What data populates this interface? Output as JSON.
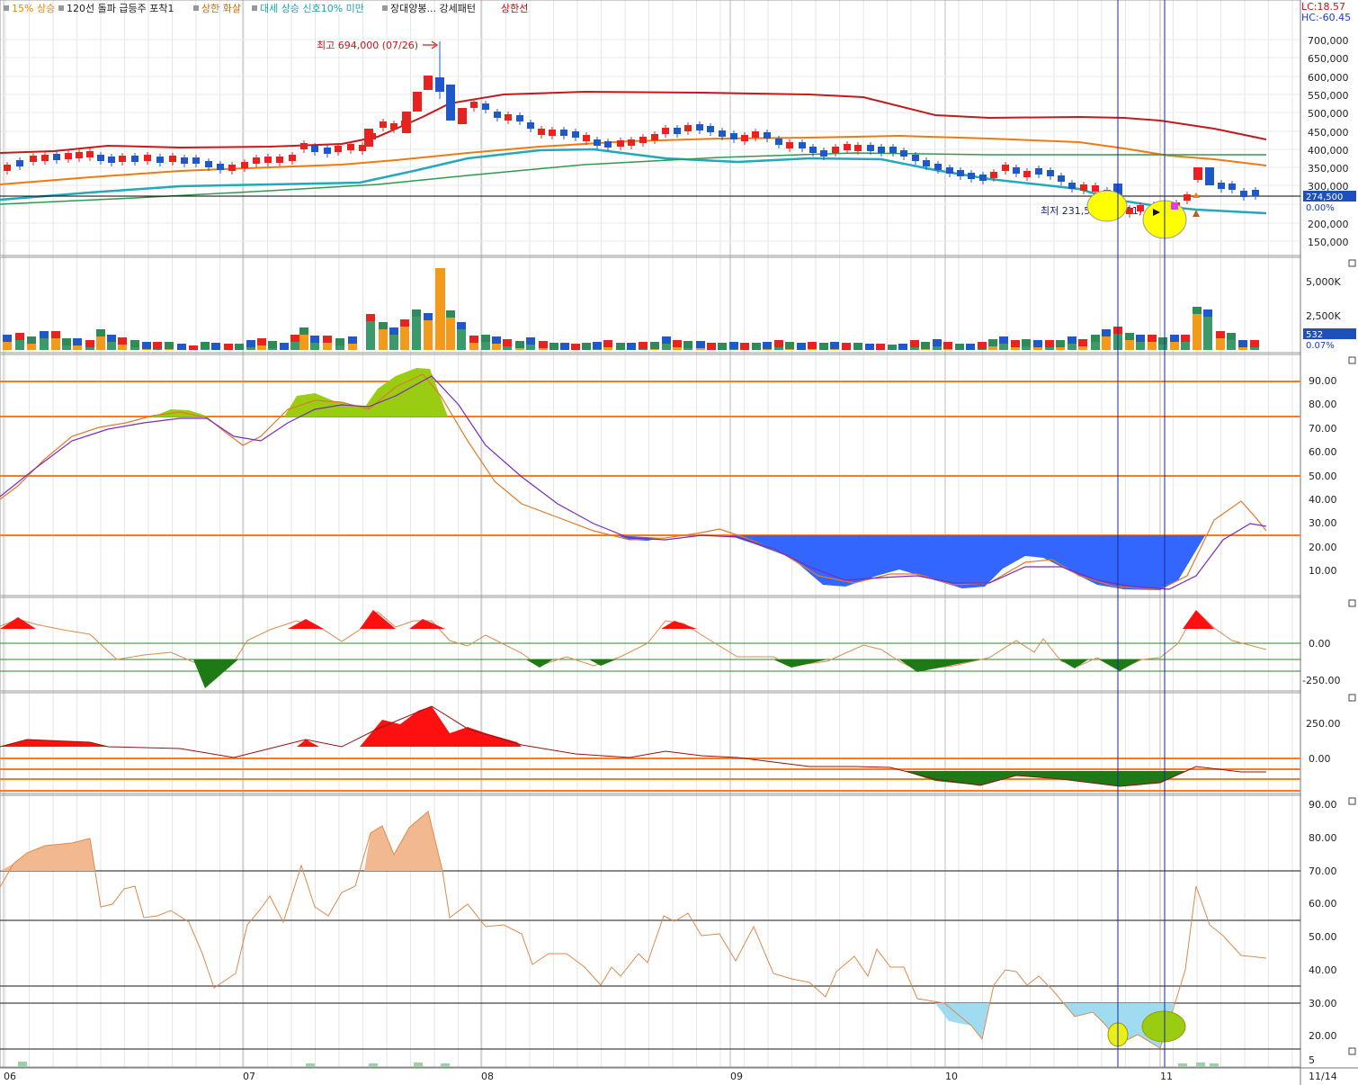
{
  "legend": [
    {
      "label": "15% 상승",
      "color": "#e08a00"
    },
    {
      "label": "120선 돌파 급등주 포착1",
      "color": "#222222"
    },
    {
      "label": "상한 화살",
      "color": "#d46a00"
    },
    {
      "label": "대세 상승 신호10% 미만",
      "color": "#19a7b0"
    },
    {
      "label": "장대양봉... 강세패턴",
      "color": "#222222"
    },
    {
      "label": "상한선",
      "color": "#cc0000"
    }
  ],
  "top_right": {
    "lc": "LC:18.57",
    "hc": "HC:-60.45"
  },
  "price_panel": {
    "ticks": [
      "700,000",
      "650,000",
      "600,000",
      "550,000",
      "500,000",
      "450,000",
      "400,000",
      "350,000",
      "300,000",
      "250,000",
      "200,000",
      "150,000"
    ],
    "max_note": "최고 694,000 (07/26)",
    "min_note": "최저 231,500 (11/01)",
    "current_badge": "274,500",
    "pct_badge": "0.00%"
  },
  "volume_panel": {
    "ticks": [
      "5,000K",
      "2,500K"
    ],
    "current_badge": "532",
    "pct_badge": "0.07%"
  },
  "stoch_panel": {
    "ticks": [
      "90.00",
      "80.00",
      "70.00",
      "60.00",
      "50.00",
      "40.00",
      "30.00",
      "20.00",
      "10.00"
    ]
  },
  "osc1_panel": {
    "ticks": [
      "0.00",
      "-250.00"
    ]
  },
  "osc2_panel": {
    "ticks": [
      "250.00",
      "0.00"
    ]
  },
  "rsi_panel": {
    "ticks": [
      "90.00",
      "80.00",
      "70.00",
      "60.00",
      "50.00",
      "40.00",
      "30.00",
      "20.00",
      "5"
    ]
  },
  "x_axis": {
    "labels": [
      "06",
      "07",
      "08",
      "09",
      "10",
      "11",
      "11/14"
    ]
  },
  "colors": {
    "up_candle": "#e8231f",
    "down_candle": "#1f58c8",
    "ma_red": "#c41a1a",
    "ma_orange": "#ef7a12",
    "ma_cyan": "#23a9bc",
    "ma_green": "#2f9a4f",
    "stoch_green": "#9acc11",
    "stoch_blue": "#3366ff",
    "osc_red": "#ff1010",
    "osc_green": "#1d7a14",
    "rsi_peach": "#f2b990",
    "rsi_sky": "#9fdcf2",
    "guide_orange": "#ff7a1a",
    "marker_yellow": "#ffff00",
    "vline": "#1a2a9e"
  },
  "chart_data": {
    "type": "candlestick",
    "x": [
      "06",
      "07",
      "08",
      "09",
      "10",
      "11",
      "11/14"
    ],
    "price_max": 694000,
    "price_min": 231500,
    "last_close": 274500,
    "last_volume": 532,
    "panels": [
      "price",
      "volume",
      "stochastic",
      "oscillator",
      "oscillator",
      "rsi"
    ]
  }
}
